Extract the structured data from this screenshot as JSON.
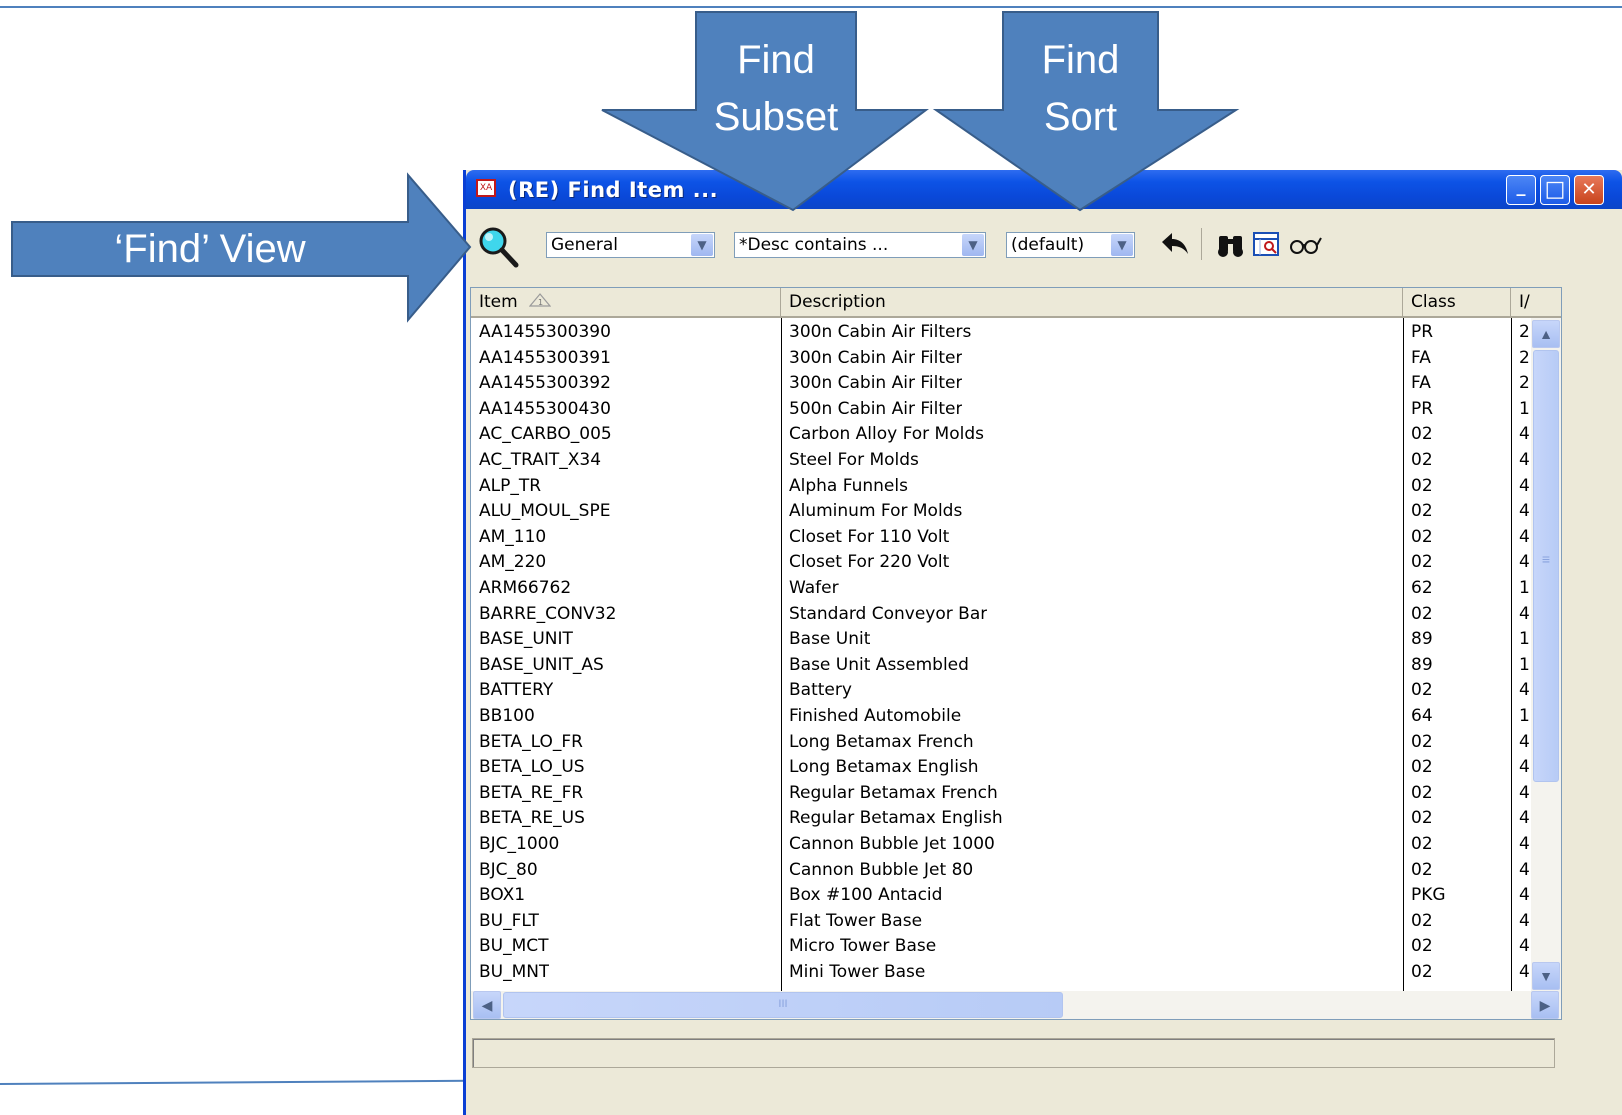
{
  "annotations": {
    "find_view": "‘Find’ View",
    "find_subset_line1": "Find",
    "find_subset_line2": "Subset",
    "find_sort_line1": "Find",
    "find_sort_line2": "Sort",
    "arrow_color": "#4f81bd"
  },
  "window": {
    "icon_text": "XA",
    "title": "(RE) Find Item ...",
    "minimize_glyph": "_",
    "maximize_glyph": "□",
    "close_glyph": "✕"
  },
  "toolbar": {
    "view_select": "General",
    "subset_select": "*Desc contains ...",
    "sort_select": "(default)",
    "dropdown_glyph": "▼",
    "icons": [
      "find-view-magnifier-icon",
      "back-arrow-icon",
      "binoculars-icon",
      "query-icon",
      "glasses-icon"
    ],
    "back_glyph": "⮪",
    "binoculars_glyph": "🔭",
    "glasses_glyph": "66"
  },
  "grid": {
    "columns": [
      "Item",
      "Description",
      "Class",
      "I/"
    ],
    "sort_indicator": "1",
    "rows": [
      [
        "AA1455300390",
        "300n Cabin Air Filters",
        "PR",
        "2"
      ],
      [
        "AA1455300391",
        "300n Cabin Air Filter",
        "FA",
        "2"
      ],
      [
        "AA1455300392",
        "300n Cabin Air Filter",
        "FA",
        "2"
      ],
      [
        "AA1455300430",
        "500n Cabin Air Filter",
        "PR",
        "1"
      ],
      [
        "AC_CARBO_005",
        "Carbon Alloy For Molds",
        "02",
        "4"
      ],
      [
        "AC_TRAIT_X34",
        "Steel For Molds",
        "02",
        "4"
      ],
      [
        "ALP_TR",
        "Alpha Funnels",
        "02",
        "4"
      ],
      [
        "ALU_MOUL_SPE",
        "Aluminum For Molds",
        "02",
        "4"
      ],
      [
        "AM_110",
        "Closet For 110 Volt",
        "02",
        "4"
      ],
      [
        "AM_220",
        "Closet For 220 Volt",
        "02",
        "4"
      ],
      [
        "ARM66762",
        "Wafer",
        "62",
        "1"
      ],
      [
        "BARRE_CONV32",
        "Standard Conveyor Bar",
        "02",
        "4"
      ],
      [
        "BASE_UNIT",
        "Base Unit",
        "89",
        "1"
      ],
      [
        "BASE_UNIT_AS",
        "Base Unit Assembled",
        "89",
        "1"
      ],
      [
        "BATTERY",
        "Battery",
        "02",
        "4"
      ],
      [
        "BB100",
        "Finished Automobile",
        "64",
        "1"
      ],
      [
        "BETA_LO_FR",
        "Long Betamax French",
        "02",
        "4"
      ],
      [
        "BETA_LO_US",
        "Long Betamax English",
        "02",
        "4"
      ],
      [
        "BETA_RE_FR",
        "Regular Betamax French",
        "02",
        "4"
      ],
      [
        "BETA_RE_US",
        "Regular Betamax English",
        "02",
        "4"
      ],
      [
        "BJC_1000",
        "Cannon Bubble Jet 1000",
        "02",
        "4"
      ],
      [
        "BJC_80",
        "Cannon Bubble Jet 80",
        "02",
        "4"
      ],
      [
        "BOX1",
        "Box #100 Antacid",
        "PKG",
        "4"
      ],
      [
        "BU_FLT",
        "Flat Tower Base",
        "02",
        "4"
      ],
      [
        "BU_MCT",
        "Micro Tower Base",
        "02",
        "4"
      ],
      [
        "BU_MNT",
        "Mini Tower Base",
        "02",
        "4"
      ]
    ]
  },
  "scrollbars": {
    "up": "▲",
    "down": "▼",
    "left": "◀",
    "right": "▶",
    "grip": "≡",
    "hgrip": "III",
    "vertical_position": 0,
    "horizontal_position": 0
  },
  "status": ""
}
